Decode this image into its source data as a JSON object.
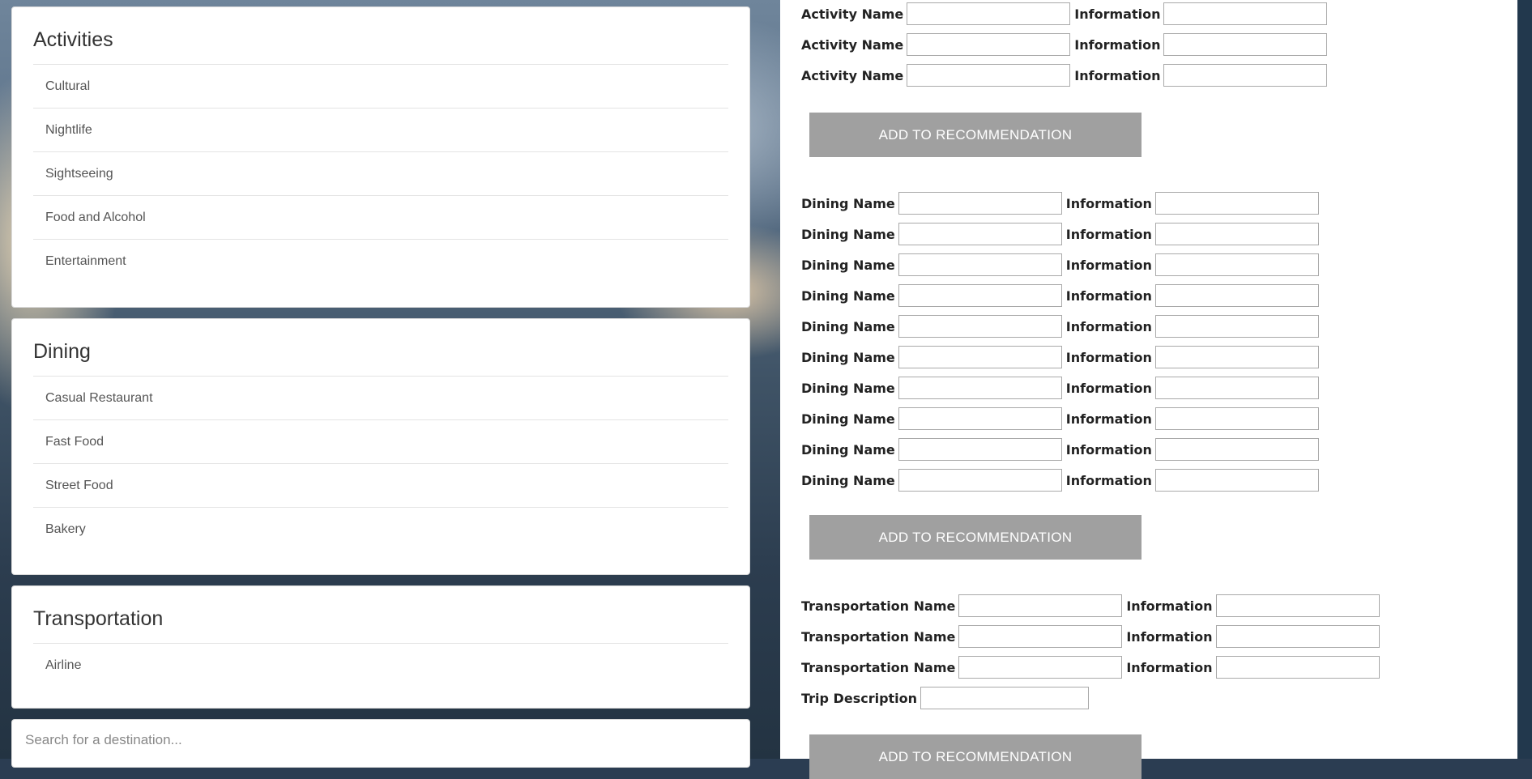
{
  "sidebar": {
    "activities": {
      "title": "Activities",
      "items": [
        {
          "label": "Cultural"
        },
        {
          "label": "Nightlife"
        },
        {
          "label": "Sightseeing"
        },
        {
          "label": "Food and Alcohol"
        },
        {
          "label": "Entertainment"
        }
      ]
    },
    "dining": {
      "title": "Dining",
      "items": [
        {
          "label": "Casual Restaurant"
        },
        {
          "label": "Fast Food"
        },
        {
          "label": "Street Food"
        },
        {
          "label": "Bakery"
        }
      ]
    },
    "transportation": {
      "title": "Transportation",
      "items": [
        {
          "label": "Airline"
        }
      ]
    },
    "search": {
      "placeholder": "Search for a destination..."
    }
  },
  "form": {
    "activity_name_label": "Activity Name",
    "dining_name_label": "Dining Name",
    "transportation_name_label": "Transportation Name",
    "information_label": "Information",
    "trip_description_label": "Trip Description",
    "add_button_label": "ADD TO RECOMMENDATION",
    "activity_rows": 3,
    "dining_rows": 10,
    "transportation_rows": 3
  }
}
